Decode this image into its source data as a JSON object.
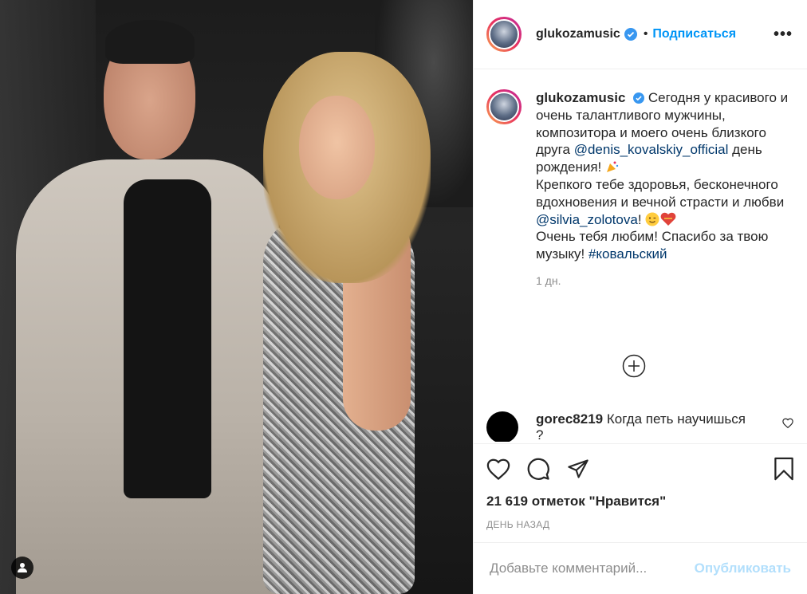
{
  "post": {
    "username": "glukozamusic",
    "follow_label": "Подписаться",
    "separator": "•",
    "more_label": "•••"
  },
  "caption": {
    "username": "glukozamusic",
    "line1": "Сегодня у красивого и очень талантливого мужчины, композитора и моего очень близкого друга ",
    "mention1": "@denis_kovalskiy_official",
    "line2": " день рождения! ",
    "line3": "Крепкого тебе здоровья, бесконечного вдохновения и вечной страсти и любви ",
    "mention2": "@silvia_zolotova",
    "line4": "! ",
    "line5": "Очень тебя любим! Спасибо за твою музыку! ",
    "hashtag": "#ковальский",
    "time": "1 дн."
  },
  "comment": {
    "username": "gorec8219",
    "text": "Когда петь научишься ?"
  },
  "stats": {
    "likes_label": "21 619 отметок \"Нравится\"",
    "date_label": "ДЕНЬ НАЗАД"
  },
  "composer": {
    "placeholder": "Добавьте комментарий...",
    "publish_label": "Опубликовать"
  },
  "colors": {
    "accent": "#0095f6",
    "mention": "#00376b",
    "muted": "#8e8e8e",
    "publish_disabled": "#b2dffc"
  },
  "icons": [
    "user-tag-icon",
    "verified-icon",
    "more-icon",
    "load-more-icon",
    "heart-icon",
    "comment-icon",
    "share-icon",
    "save-icon",
    "small-heart-icon"
  ]
}
